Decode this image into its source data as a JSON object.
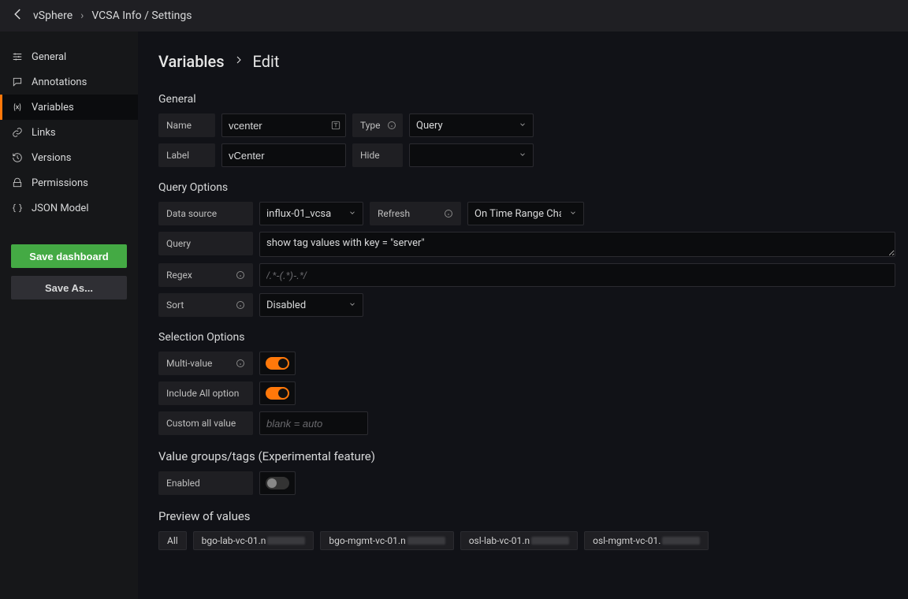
{
  "breadcrumb": {
    "root": "vSphere",
    "page": "VCSA Info / Settings"
  },
  "sidebar": {
    "items": [
      {
        "label": "General"
      },
      {
        "label": "Annotations"
      },
      {
        "label": "Variables"
      },
      {
        "label": "Links"
      },
      {
        "label": "Versions"
      },
      {
        "label": "Permissions"
      },
      {
        "label": "JSON Model"
      }
    ],
    "save_label": "Save dashboard",
    "saveas_label": "Save As..."
  },
  "title": {
    "variables": "Variables",
    "edit": "Edit"
  },
  "sections": {
    "general": "General",
    "query_options": "Query Options",
    "selection_options": "Selection Options",
    "value_groups": "Value groups/tags (Experimental feature)",
    "preview": "Preview of values"
  },
  "general": {
    "name_label": "Name",
    "name_value": "vcenter",
    "label_label": "Label",
    "label_value": "vCenter",
    "type_label": "Type",
    "type_value": "Query",
    "hide_label": "Hide",
    "hide_value": ""
  },
  "query": {
    "datasource_label": "Data source",
    "datasource_value": "influx-01_vcsa",
    "refresh_label": "Refresh",
    "refresh_value": "On Time Range Chan",
    "query_label": "Query",
    "query_value": "show tag values with key = \"server\"",
    "regex_label": "Regex",
    "regex_placeholder": "/.*-(.*)-.*/",
    "sort_label": "Sort",
    "sort_value": "Disabled"
  },
  "selection": {
    "multi_label": "Multi-value",
    "include_all_label": "Include All option",
    "custom_label": "Custom all value",
    "custom_placeholder": "blank = auto"
  },
  "value_groups": {
    "enabled_label": "Enabled"
  },
  "preview": {
    "items": [
      "All",
      "bgo-lab-vc-01.n",
      "bgo-mgmt-vc-01.n",
      "osl-lab-vc-01.n",
      "osl-mgmt-vc-01."
    ]
  }
}
